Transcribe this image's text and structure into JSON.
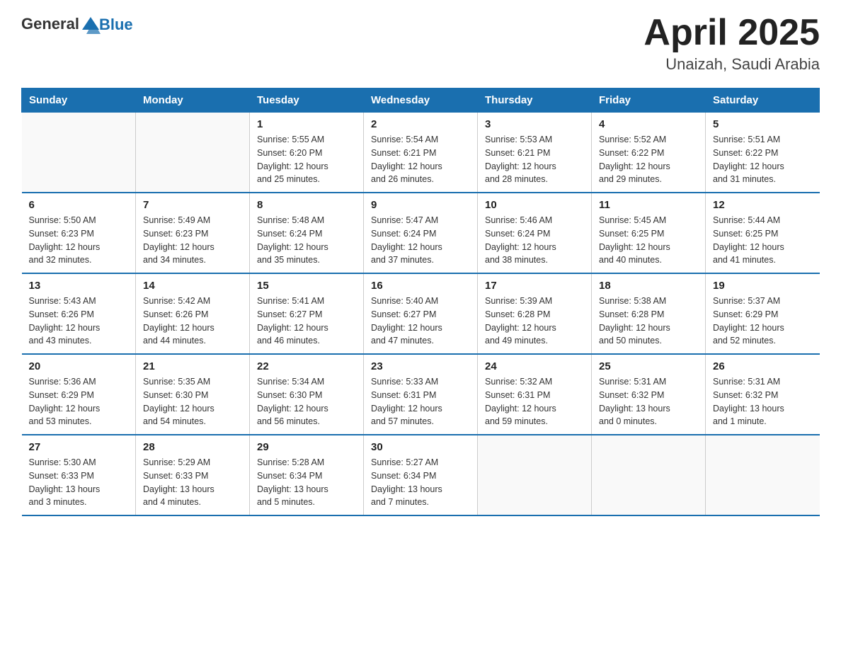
{
  "logo": {
    "text_general": "General",
    "text_blue": "Blue"
  },
  "title": {
    "month": "April 2025",
    "location": "Unaizah, Saudi Arabia"
  },
  "days_of_week": [
    "Sunday",
    "Monday",
    "Tuesday",
    "Wednesday",
    "Thursday",
    "Friday",
    "Saturday"
  ],
  "weeks": [
    [
      {
        "day": "",
        "info": ""
      },
      {
        "day": "",
        "info": ""
      },
      {
        "day": "1",
        "info": "Sunrise: 5:55 AM\nSunset: 6:20 PM\nDaylight: 12 hours\nand 25 minutes."
      },
      {
        "day": "2",
        "info": "Sunrise: 5:54 AM\nSunset: 6:21 PM\nDaylight: 12 hours\nand 26 minutes."
      },
      {
        "day": "3",
        "info": "Sunrise: 5:53 AM\nSunset: 6:21 PM\nDaylight: 12 hours\nand 28 minutes."
      },
      {
        "day": "4",
        "info": "Sunrise: 5:52 AM\nSunset: 6:22 PM\nDaylight: 12 hours\nand 29 minutes."
      },
      {
        "day": "5",
        "info": "Sunrise: 5:51 AM\nSunset: 6:22 PM\nDaylight: 12 hours\nand 31 minutes."
      }
    ],
    [
      {
        "day": "6",
        "info": "Sunrise: 5:50 AM\nSunset: 6:23 PM\nDaylight: 12 hours\nand 32 minutes."
      },
      {
        "day": "7",
        "info": "Sunrise: 5:49 AM\nSunset: 6:23 PM\nDaylight: 12 hours\nand 34 minutes."
      },
      {
        "day": "8",
        "info": "Sunrise: 5:48 AM\nSunset: 6:24 PM\nDaylight: 12 hours\nand 35 minutes."
      },
      {
        "day": "9",
        "info": "Sunrise: 5:47 AM\nSunset: 6:24 PM\nDaylight: 12 hours\nand 37 minutes."
      },
      {
        "day": "10",
        "info": "Sunrise: 5:46 AM\nSunset: 6:24 PM\nDaylight: 12 hours\nand 38 minutes."
      },
      {
        "day": "11",
        "info": "Sunrise: 5:45 AM\nSunset: 6:25 PM\nDaylight: 12 hours\nand 40 minutes."
      },
      {
        "day": "12",
        "info": "Sunrise: 5:44 AM\nSunset: 6:25 PM\nDaylight: 12 hours\nand 41 minutes."
      }
    ],
    [
      {
        "day": "13",
        "info": "Sunrise: 5:43 AM\nSunset: 6:26 PM\nDaylight: 12 hours\nand 43 minutes."
      },
      {
        "day": "14",
        "info": "Sunrise: 5:42 AM\nSunset: 6:26 PM\nDaylight: 12 hours\nand 44 minutes."
      },
      {
        "day": "15",
        "info": "Sunrise: 5:41 AM\nSunset: 6:27 PM\nDaylight: 12 hours\nand 46 minutes."
      },
      {
        "day": "16",
        "info": "Sunrise: 5:40 AM\nSunset: 6:27 PM\nDaylight: 12 hours\nand 47 minutes."
      },
      {
        "day": "17",
        "info": "Sunrise: 5:39 AM\nSunset: 6:28 PM\nDaylight: 12 hours\nand 49 minutes."
      },
      {
        "day": "18",
        "info": "Sunrise: 5:38 AM\nSunset: 6:28 PM\nDaylight: 12 hours\nand 50 minutes."
      },
      {
        "day": "19",
        "info": "Sunrise: 5:37 AM\nSunset: 6:29 PM\nDaylight: 12 hours\nand 52 minutes."
      }
    ],
    [
      {
        "day": "20",
        "info": "Sunrise: 5:36 AM\nSunset: 6:29 PM\nDaylight: 12 hours\nand 53 minutes."
      },
      {
        "day": "21",
        "info": "Sunrise: 5:35 AM\nSunset: 6:30 PM\nDaylight: 12 hours\nand 54 minutes."
      },
      {
        "day": "22",
        "info": "Sunrise: 5:34 AM\nSunset: 6:30 PM\nDaylight: 12 hours\nand 56 minutes."
      },
      {
        "day": "23",
        "info": "Sunrise: 5:33 AM\nSunset: 6:31 PM\nDaylight: 12 hours\nand 57 minutes."
      },
      {
        "day": "24",
        "info": "Sunrise: 5:32 AM\nSunset: 6:31 PM\nDaylight: 12 hours\nand 59 minutes."
      },
      {
        "day": "25",
        "info": "Sunrise: 5:31 AM\nSunset: 6:32 PM\nDaylight: 13 hours\nand 0 minutes."
      },
      {
        "day": "26",
        "info": "Sunrise: 5:31 AM\nSunset: 6:32 PM\nDaylight: 13 hours\nand 1 minute."
      }
    ],
    [
      {
        "day": "27",
        "info": "Sunrise: 5:30 AM\nSunset: 6:33 PM\nDaylight: 13 hours\nand 3 minutes."
      },
      {
        "day": "28",
        "info": "Sunrise: 5:29 AM\nSunset: 6:33 PM\nDaylight: 13 hours\nand 4 minutes."
      },
      {
        "day": "29",
        "info": "Sunrise: 5:28 AM\nSunset: 6:34 PM\nDaylight: 13 hours\nand 5 minutes."
      },
      {
        "day": "30",
        "info": "Sunrise: 5:27 AM\nSunset: 6:34 PM\nDaylight: 13 hours\nand 7 minutes."
      },
      {
        "day": "",
        "info": ""
      },
      {
        "day": "",
        "info": ""
      },
      {
        "day": "",
        "info": ""
      }
    ]
  ]
}
